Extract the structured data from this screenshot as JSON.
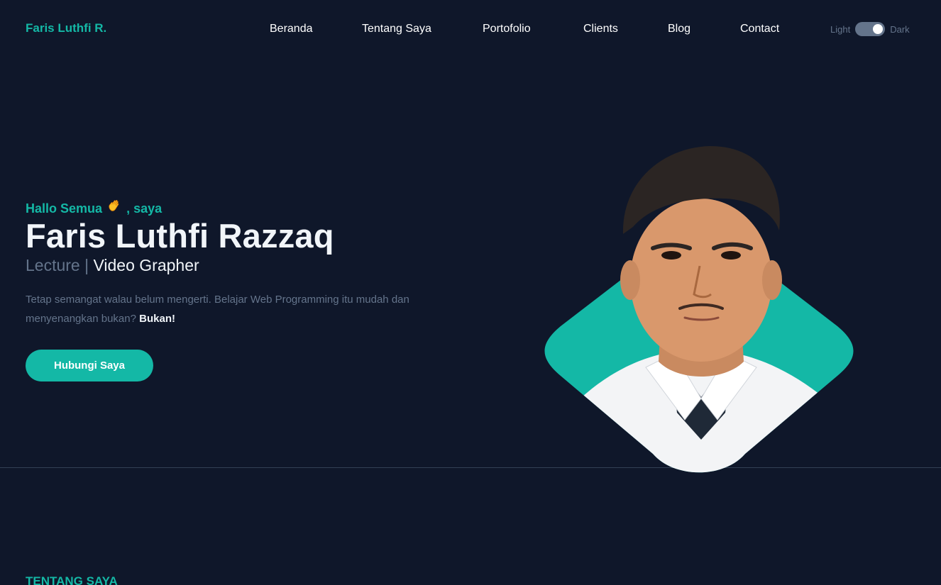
{
  "header": {
    "brand": "Faris Luthfi R.",
    "nav": [
      {
        "label": "Beranda"
      },
      {
        "label": "Tentang Saya"
      },
      {
        "label": "Portofolio"
      },
      {
        "label": "Clients"
      },
      {
        "label": "Blog"
      },
      {
        "label": "Contact"
      }
    ],
    "theme_toggle": {
      "light_label": "Light",
      "dark_label": "Dark",
      "state": "dark"
    }
  },
  "hero": {
    "greeting_prefix": "Hallo Semua",
    "greeting_icon": "waving-hand-icon",
    "greeting_suffix": ", saya",
    "name": "Faris Luthfi Razzaq",
    "role_primary": "Lecture",
    "role_separator": " | ",
    "role_secondary": "Video Grapher",
    "tagline": "Tetap semangat walau belum mengerti. Belajar Web Programming itu mudah dan menyenangkan bukan?",
    "tagline_emphasis": "Bukan!",
    "cta_label": "Hubungi Saya"
  },
  "next_section": {
    "heading": "TENTANG SAYA"
  },
  "colors": {
    "background": "#0f172a",
    "accent": "#14b8a6",
    "text_primary": "#f1f5f9",
    "text_muted": "#64748b",
    "divider": "#334155"
  }
}
